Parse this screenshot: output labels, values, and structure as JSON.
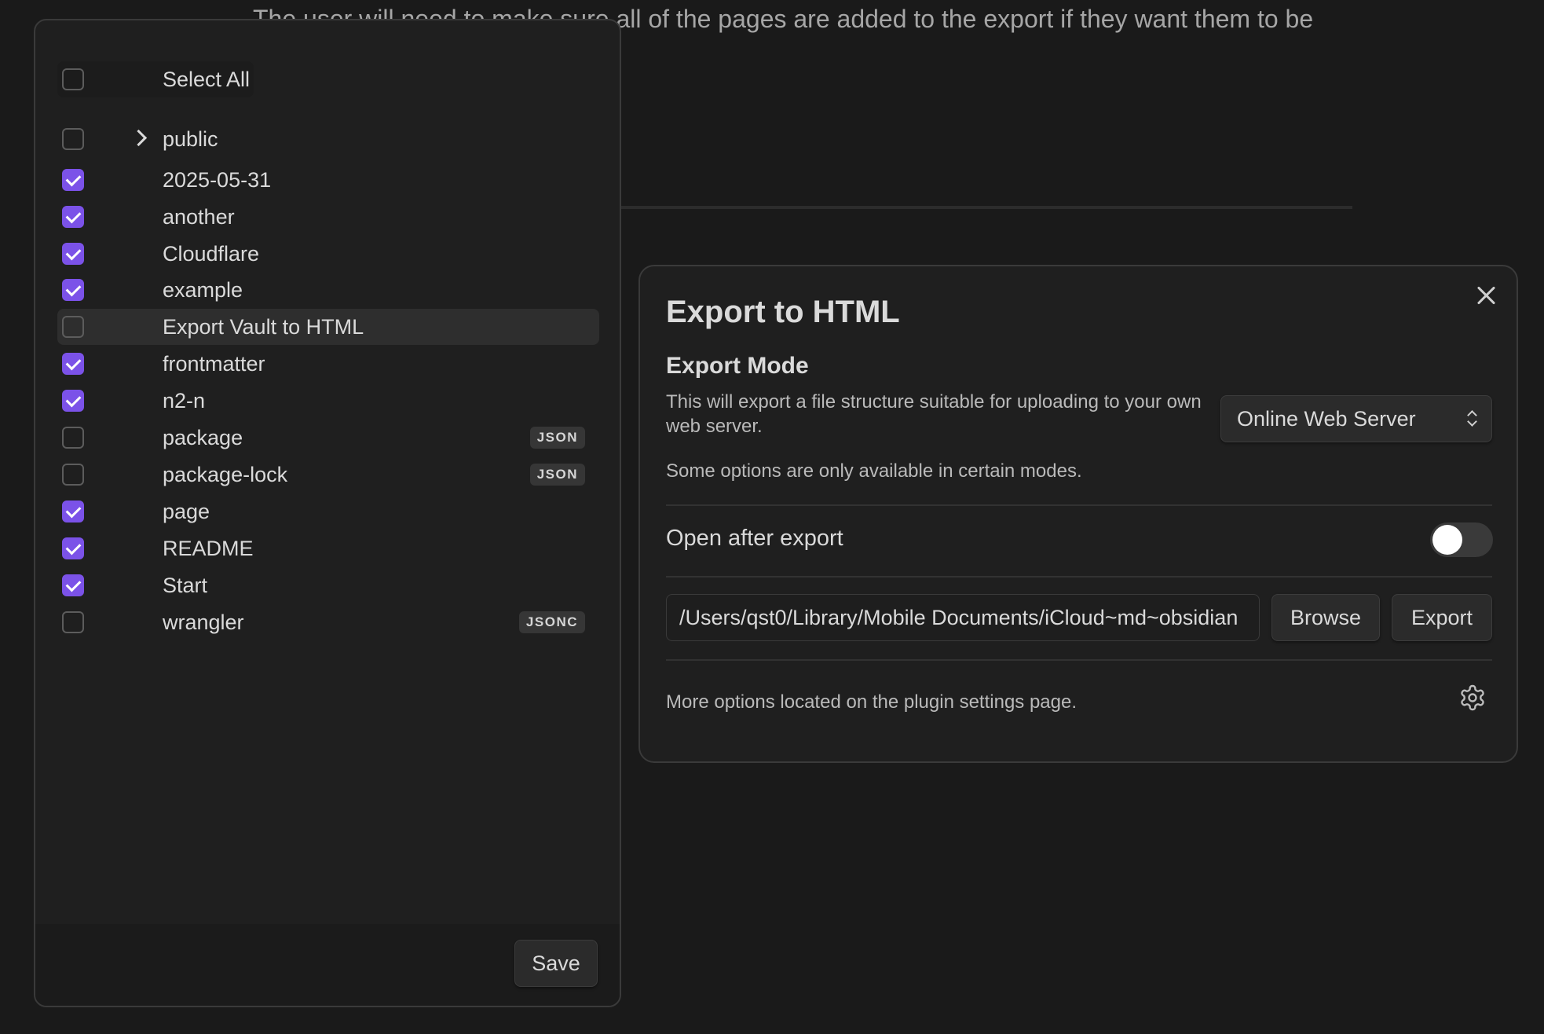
{
  "background": {
    "doc_text": "The user will need to make sure all of the pages are added to the export if they want them to be"
  },
  "picker": {
    "select_all_label": "Select All",
    "items": [
      {
        "label": "public",
        "checked": false,
        "folder": true,
        "tag": ""
      },
      {
        "label": "2025-05-31",
        "checked": true,
        "folder": false,
        "tag": ""
      },
      {
        "label": "another",
        "checked": true,
        "folder": false,
        "tag": ""
      },
      {
        "label": "Cloudflare",
        "checked": true,
        "folder": false,
        "tag": ""
      },
      {
        "label": "example",
        "checked": true,
        "folder": false,
        "tag": ""
      },
      {
        "label": "Export Vault to HTML",
        "checked": false,
        "folder": false,
        "tag": "",
        "hovered": true
      },
      {
        "label": "frontmatter",
        "checked": true,
        "folder": false,
        "tag": ""
      },
      {
        "label": "n2-n",
        "checked": true,
        "folder": false,
        "tag": ""
      },
      {
        "label": "package",
        "checked": false,
        "folder": false,
        "tag": "JSON"
      },
      {
        "label": "package-lock",
        "checked": false,
        "folder": false,
        "tag": "JSON"
      },
      {
        "label": "page",
        "checked": true,
        "folder": false,
        "tag": ""
      },
      {
        "label": "README",
        "checked": true,
        "folder": false,
        "tag": ""
      },
      {
        "label": "Start",
        "checked": true,
        "folder": false,
        "tag": ""
      },
      {
        "label": "wrangler",
        "checked": false,
        "folder": false,
        "tag": "JSONC"
      }
    ],
    "save_label": "Save"
  },
  "modal": {
    "title": "Export to HTML",
    "export_mode_heading": "Export Mode",
    "export_mode_description": "This will export a file structure suitable for uploading to your own web server.",
    "modes_note": "Some options are only available in certain modes.",
    "mode_select_value": "Online Web Server",
    "open_after_export_label": "Open after export",
    "open_after_export_enabled": false,
    "path_value": "/Users/qst0/Library/Mobile Documents/iCloud~md~obsidian",
    "browse_label": "Browse",
    "export_label": "Export",
    "more_options_text": "More options located on the plugin settings page."
  },
  "colors": {
    "accent": "#7b52e8",
    "background": "#1a1a1a",
    "panel": "#1f1f1f"
  }
}
